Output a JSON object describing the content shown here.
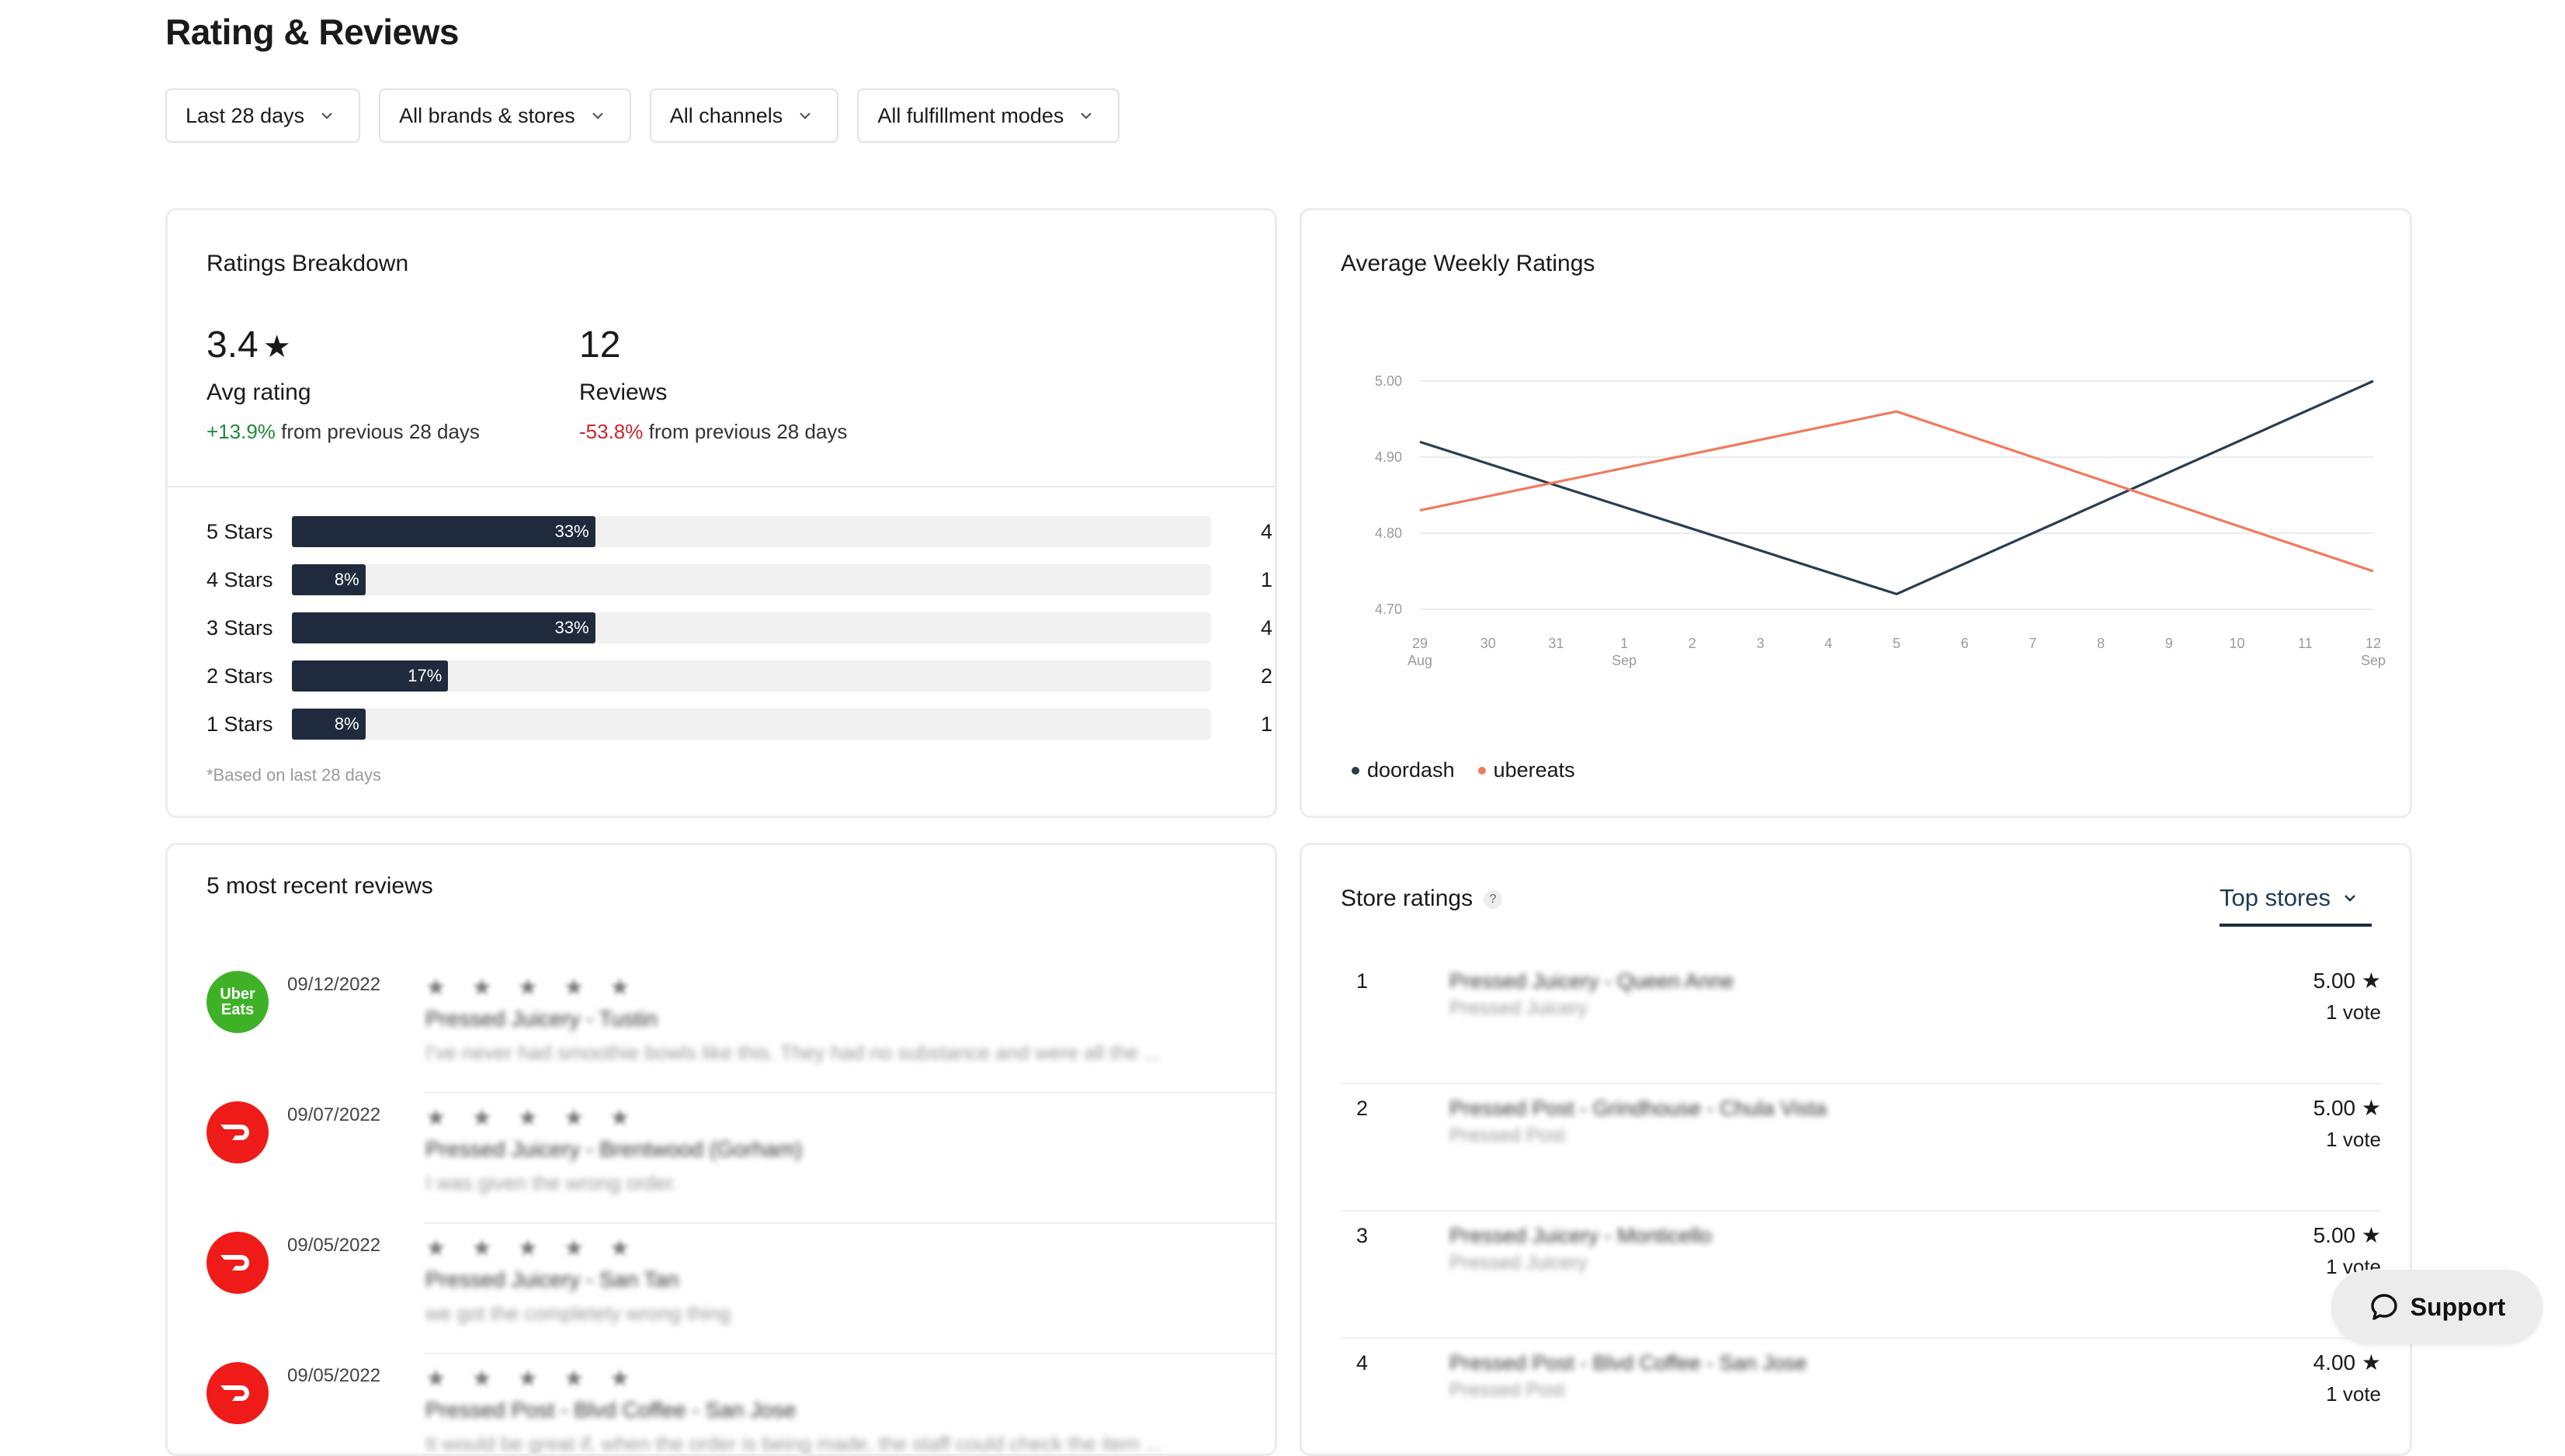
{
  "page": {
    "title": "Rating & Reviews"
  },
  "filters": [
    {
      "label": "Last 28 days"
    },
    {
      "label": "All brands & stores"
    },
    {
      "label": "All channels"
    },
    {
      "label": "All fulfillment modes"
    }
  ],
  "breakdown": {
    "title": "Ratings Breakdown",
    "avg_rating": "3.4",
    "avg_label": "Avg rating",
    "avg_change": "+13.9%",
    "avg_change_suffix": "from previous 28 days",
    "reviews": "12",
    "reviews_label": "Reviews",
    "reviews_change": "-53.8%",
    "reviews_change_suffix": "from previous 28 days",
    "rows": [
      {
        "label": "5 Stars",
        "pct_label": "33%",
        "pct": 0.33,
        "count": "4"
      },
      {
        "label": "4 Stars",
        "pct_label": "8%",
        "pct": 0.08,
        "count": "1"
      },
      {
        "label": "3 Stars",
        "pct_label": "33%",
        "pct": 0.33,
        "count": "4"
      },
      {
        "label": "2 Stars",
        "pct_label": "17%",
        "pct": 0.17,
        "count": "2"
      },
      {
        "label": "1 Stars",
        "pct_label": "8%",
        "pct": 0.08,
        "count": "1"
      }
    ],
    "footnote": "*Based on last 28 days"
  },
  "weekly": {
    "title": "Average Weekly Ratings",
    "legend": [
      {
        "name": "doordash",
        "color": "#2b3d4f"
      },
      {
        "name": "ubereats",
        "color": "#f07a5e"
      }
    ]
  },
  "chart_data": {
    "type": "line",
    "ylim": [
      4.7,
      5.0
    ],
    "yticks": [
      "5.00",
      "4.90",
      "4.80",
      "4.70"
    ],
    "x_ticks": [
      {
        "day": "29",
        "month": "Aug"
      },
      {
        "day": "30",
        "month": ""
      },
      {
        "day": "31",
        "month": ""
      },
      {
        "day": "1",
        "month": "Sep"
      },
      {
        "day": "2",
        "month": ""
      },
      {
        "day": "3",
        "month": ""
      },
      {
        "day": "4",
        "month": ""
      },
      {
        "day": "5",
        "month": ""
      },
      {
        "day": "6",
        "month": ""
      },
      {
        "day": "7",
        "month": ""
      },
      {
        "day": "8",
        "month": ""
      },
      {
        "day": "9",
        "month": ""
      },
      {
        "day": "10",
        "month": ""
      },
      {
        "day": "11",
        "month": ""
      },
      {
        "day": "12",
        "month": "Sep"
      }
    ],
    "x": [
      "2022-08-29",
      "2022-09-05",
      "2022-09-12"
    ],
    "series": [
      {
        "name": "doordash",
        "values": [
          4.92,
          4.72,
          5.0
        ]
      },
      {
        "name": "ubereats",
        "values": [
          4.83,
          4.96,
          4.75
        ]
      }
    ]
  },
  "recent": {
    "title": "5 most recent reviews",
    "items": [
      {
        "source": "Uber Eats",
        "date": "09/12/2022",
        "stars": "★ ★ ★ ★ ★",
        "store": "Pressed Juicery - Tustin",
        "text": "I've never had smoothie bowls like this. They had no substance and were all the ..."
      },
      {
        "source": "DoorDash",
        "date": "09/07/2022",
        "stars": "★ ★ ★ ★ ★",
        "store": "Pressed Juicery - Brentwood (Gorham)",
        "text": "I was given the wrong order."
      },
      {
        "source": "DoorDash",
        "date": "09/05/2022",
        "stars": "★ ★ ★ ★ ★",
        "store": "Pressed Juicery - San Tan",
        "text": "we got the completely wrong thing"
      },
      {
        "source": "DoorDash",
        "date": "09/05/2022",
        "stars": "★ ★ ★ ★ ★",
        "store": "Pressed Post - Blvd Coffee - San Jose",
        "text": "It would be great if, when the order is being made, the staff could check the item ..."
      }
    ]
  },
  "stores": {
    "title": "Store ratings",
    "help": "?",
    "sort_label": "Top stores",
    "items": [
      {
        "rank": "1",
        "name": "Pressed Juicery - Queen Anne",
        "brand": "Pressed Juicery",
        "rating": "5.00",
        "votes": "1 vote"
      },
      {
        "rank": "2",
        "name": "Pressed Post - Grindhouse - Chula Vista",
        "brand": "Pressed Post",
        "rating": "5.00",
        "votes": "1 vote"
      },
      {
        "rank": "3",
        "name": "Pressed Juicery - Monticello",
        "brand": "Pressed Juicery",
        "rating": "5.00",
        "votes": "1 vote"
      },
      {
        "rank": "4",
        "name": "Pressed Post - Blvd Coffee - San Jose",
        "brand": "Pressed Post",
        "rating": "4.00",
        "votes": "1 vote"
      }
    ]
  },
  "support": {
    "label": "Support"
  }
}
